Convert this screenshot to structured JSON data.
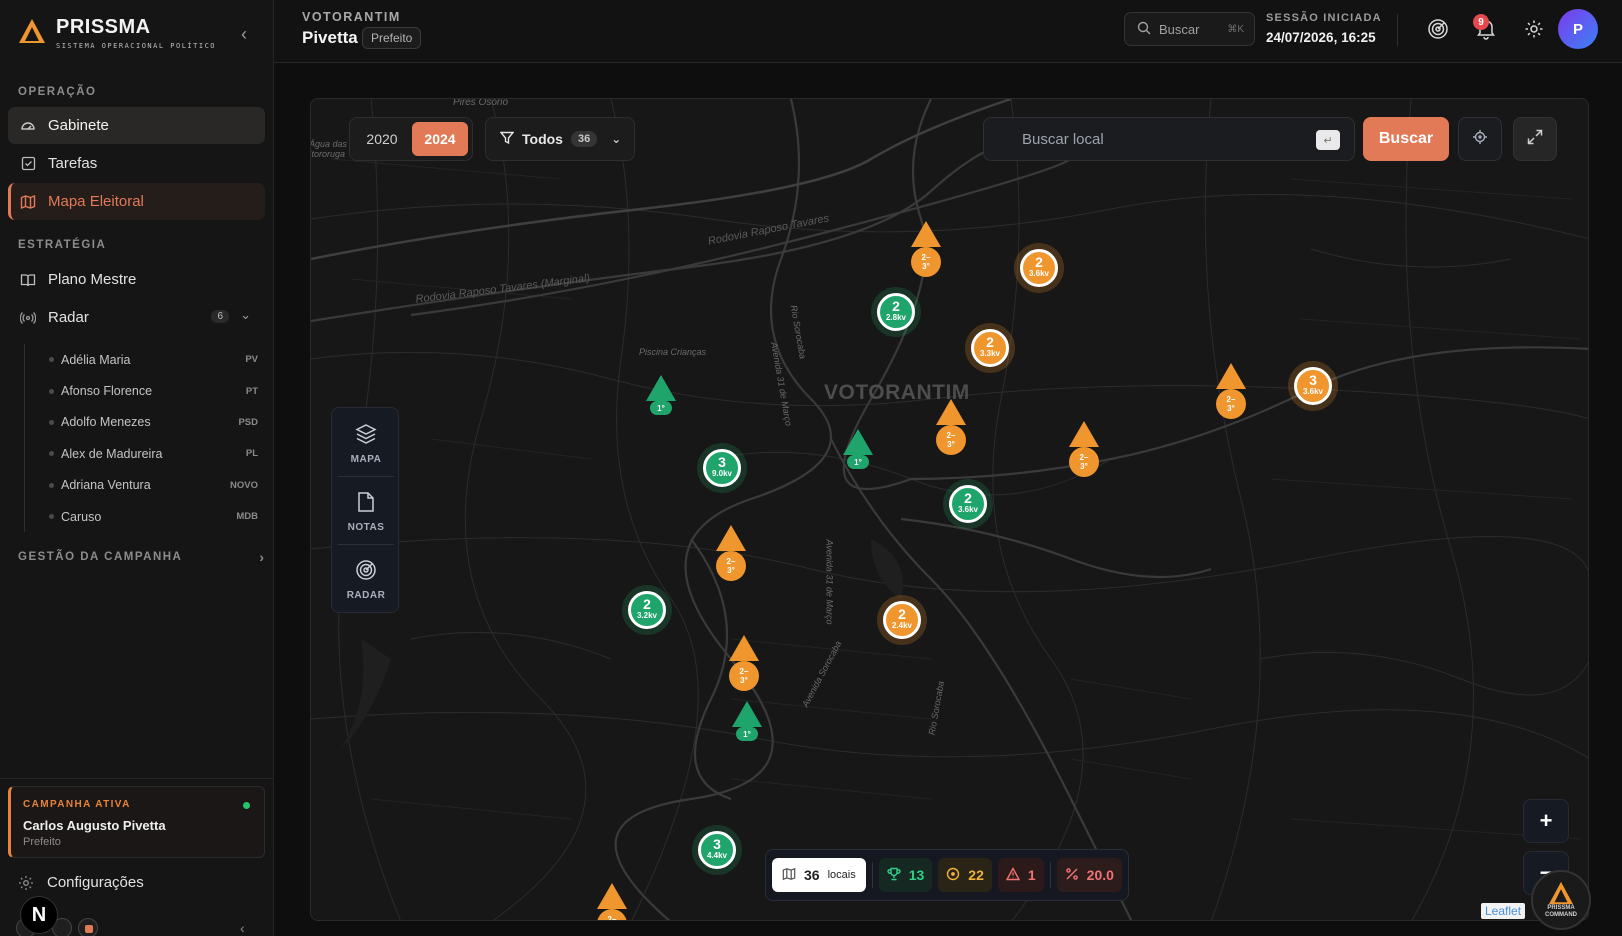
{
  "brand": {
    "name": "PRISSMA",
    "subtitle": "SISTEMA OPERACIONAL POLÍTICO",
    "collapse_icon": "chevron-left-icon"
  },
  "sidebar": {
    "sections": {
      "operacao": "OPERAÇÃO",
      "estrategia": "ESTRATÉGIA",
      "gestao": "GESTÃO DA CAMPANHA"
    },
    "operacao_items": [
      {
        "label": "Gabinete",
        "icon": "gauge-icon"
      },
      {
        "label": "Tarefas",
        "icon": "checkbox-icon"
      },
      {
        "label": "Mapa Eleitoral",
        "icon": "map-icon"
      }
    ],
    "estrategia_items": [
      {
        "label": "Plano Mestre",
        "icon": "book-icon"
      },
      {
        "label": "Radar",
        "icon": "radar-icon",
        "count": "6"
      }
    ],
    "radar_items": [
      {
        "name": "Adélia Maria",
        "party": "PV"
      },
      {
        "name": "Afonso Florence",
        "party": "PT"
      },
      {
        "name": "Adolfo Menezes",
        "party": "PSD"
      },
      {
        "name": "Alex de Madureira",
        "party": "PL"
      },
      {
        "name": "Adriana Ventura",
        "party": "NOVO"
      },
      {
        "name": "Caruso",
        "party": "MDB"
      }
    ],
    "campaign": {
      "label": "CAMPANHA ATIVA",
      "name": "Carlos Augusto Pivetta",
      "role": "Prefeito",
      "status_color": "#27c26c"
    },
    "config_label": "Configurações",
    "n_badge": "N"
  },
  "header": {
    "crumb": "VOTORANTIM",
    "title": "Pivetta",
    "role": "Prefeito",
    "search_placeholder": "Buscar",
    "search_shortcut": "⌘K",
    "session_label": "SESSÃO INICIADA",
    "session_value": "24/07/2026, 16:25",
    "notifications": "9",
    "avatar": "P"
  },
  "map": {
    "years": [
      "2020",
      "2024"
    ],
    "selected_year": "2024",
    "filter_label": "Todos",
    "filter_count": "36",
    "search_placeholder": "Buscar local",
    "enter_key": "↵",
    "search_button": "Buscar",
    "city": "VOTORANTIM",
    "labels": {
      "pires": "Pires Osório",
      "agua": "Água das Itororuga",
      "raposo1": "Rodovia Raposo Tavares",
      "raposo2": "Rodovia Raposo Tavares (Marginal)",
      "piscina": "Piscina Crianças",
      "avenida1": "Avenida 31 de Março",
      "avenida2": "Avenida 31 de Março",
      "rio": "Rio Sorocaba",
      "rio2": "Rio Sorocaba",
      "avsoro": "Avenida Sorocaba"
    },
    "layers": [
      {
        "label": "MAPA",
        "icon": "layers-icon"
      },
      {
        "label": "NOTAS",
        "icon": "note-icon"
      },
      {
        "label": "RADAR",
        "icon": "radar-icon"
      }
    ],
    "tri_label_o": "2–\n3°",
    "tri_label_g": "1°",
    "clusters": [
      {
        "n": "2",
        "v": "2.8kv",
        "c": "g"
      },
      {
        "n": "2",
        "v": "3.6kv",
        "c": "o"
      },
      {
        "n": "2",
        "v": "3.3kv",
        "c": "o"
      },
      {
        "n": "3",
        "v": "3.6kv",
        "c": "o"
      },
      {
        "n": "3",
        "v": "9.0kv",
        "c": "g"
      },
      {
        "n": "2",
        "v": "3.6kv",
        "c": "g"
      },
      {
        "n": "2",
        "v": "3.2kv",
        "c": "g"
      },
      {
        "n": "2",
        "v": "2.4kv",
        "c": "o"
      },
      {
        "n": "3",
        "v": "4.4kv",
        "c": "g"
      }
    ],
    "stats": {
      "locais_count": "36",
      "locais_label": "locais",
      "wins": "13",
      "second": "22",
      "alerts": "1",
      "rate": "20.0"
    },
    "zoom_in": "+",
    "zoom_out": "−",
    "attribution": "Leaflet",
    "cmd_line1": "PRISSMA",
    "cmd_line2": "COMMAND"
  }
}
